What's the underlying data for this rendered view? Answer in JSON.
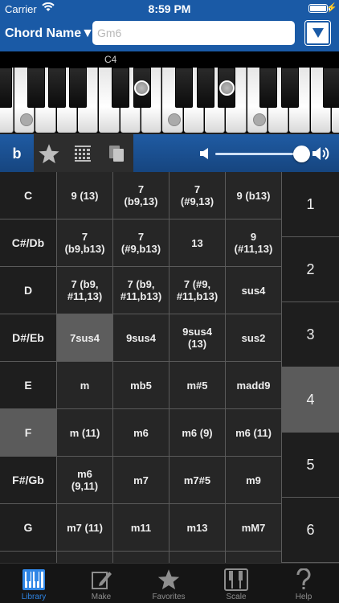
{
  "status_bar": {
    "carrier": "Carrier",
    "time": "8:59 PM"
  },
  "header": {
    "chord_name_label": "Chord Name▼",
    "chord_input_placeholder": "Gm6"
  },
  "keyboard": {
    "octave_label": "C4"
  },
  "toolbar": {
    "flat_label": "b",
    "volume_level": 1.0
  },
  "roots": [
    {
      "label": "C"
    },
    {
      "label": "C#/Db"
    },
    {
      "label": "D"
    },
    {
      "label": "D#/Eb"
    },
    {
      "label": "E"
    },
    {
      "label": "F",
      "selected": true
    },
    {
      "label": "F#/Gb"
    },
    {
      "label": "G"
    },
    {
      "label": ""
    }
  ],
  "chords": [
    "9 (13)",
    "7\n(b9,13)",
    "7\n(#9,13)",
    "9 (b13)",
    "7\n(b9,b13)",
    "7\n(#9,b13)",
    "13",
    "9\n(#11,13)",
    "7 (b9,\n#11,13)",
    "7 (b9,\n#11,b13)",
    "7 (#9,\n#11,b13)",
    "sus4",
    "7sus4",
    "9sus4",
    "9sus4\n(13)",
    "sus2",
    "m",
    "mb5",
    "m#5",
    "madd9",
    "m (11)",
    "m6",
    "m6 (9)",
    "m6 (11)",
    "m6\n(9,11)",
    "m7",
    "m7#5",
    "m9",
    "m7 (11)",
    "m11",
    "m13",
    "mM7",
    "",
    "mM7",
    "",
    ""
  ],
  "selected_chord": "7sus4",
  "numbers": [
    {
      "label": "1"
    },
    {
      "label": "2"
    },
    {
      "label": "3"
    },
    {
      "label": "4",
      "selected": true
    },
    {
      "label": "5"
    },
    {
      "label": "6"
    }
  ],
  "tabs": [
    {
      "label": "Library",
      "icon": "library-icon",
      "active": true
    },
    {
      "label": "Make",
      "icon": "pencil-icon"
    },
    {
      "label": "Favorites",
      "icon": "star-icon"
    },
    {
      "label": "Scale",
      "icon": "scale-icon"
    },
    {
      "label": "Help",
      "icon": "help-icon"
    }
  ],
  "colors": {
    "brand_blue": "#1a5aa6",
    "tab_active": "#2f86e6",
    "selected_cell": "#5b5b5b"
  }
}
